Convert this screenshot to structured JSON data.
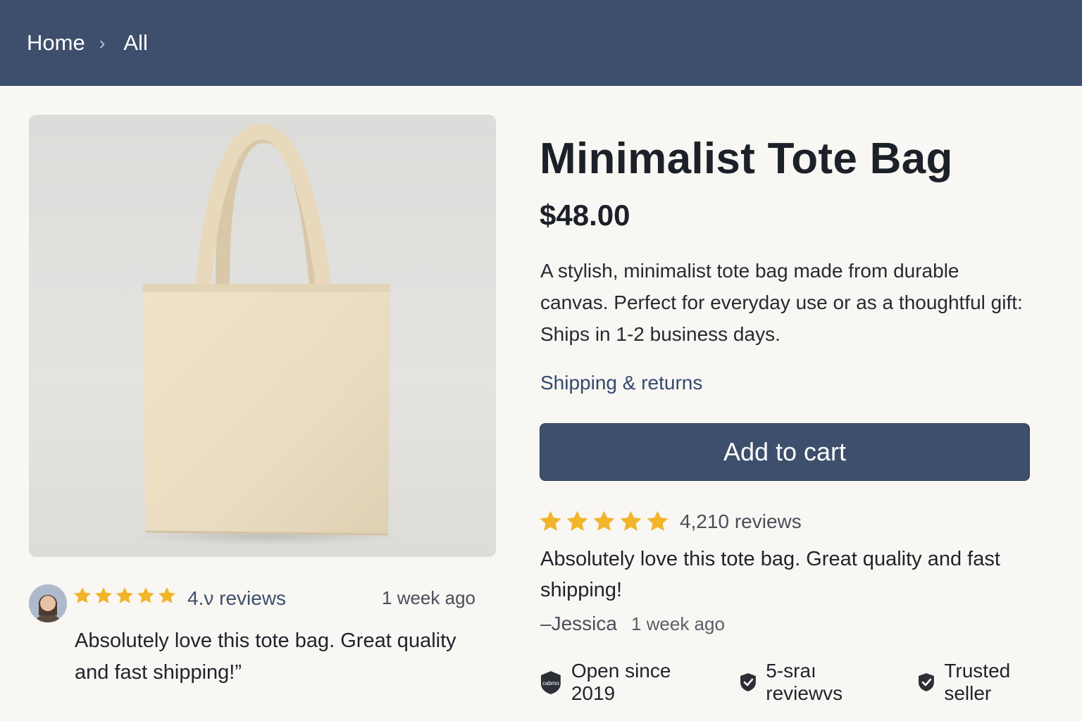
{
  "header": {
    "breadcrumbs": [
      "Home",
      "All"
    ]
  },
  "product": {
    "title": "Minimalist Tote Bag",
    "price": "$48.00",
    "description": "A stylish, minimalist tote bag made from durable canvas. Perfect for everyday use or as a thoughtful gift: Ships in 1-2 business days.",
    "shipping_link": "Shipping & returns",
    "cart_button": "Add to cart"
  },
  "left_review": {
    "stars": 5,
    "rating_text": "4.ν reviews",
    "time": "1 week ago",
    "quote": "Absolutely love this tote bag. Great quality and fast shipping!”"
  },
  "rating": {
    "stars": 5,
    "count_text": "4,210 reviews"
  },
  "featured_review": {
    "quote": "Absolutely love this tote bag. Great quality and fast shipping!",
    "author": "–Jessica",
    "time": "1 week ago"
  },
  "badges": [
    {
      "label": "Open since 2019",
      "icon": "store-badge-icon",
      "icon_text": "cabmo"
    },
    {
      "label": "5-sraı reviewvs",
      "icon": "shield-check-icon"
    },
    {
      "label": "Trusted seller",
      "icon": "shield-check-icon"
    }
  ],
  "colors": {
    "header": "#3d4f6c",
    "background": "#f8f7f3",
    "star": "#f2b42a",
    "button": "#3d4f6c"
  }
}
